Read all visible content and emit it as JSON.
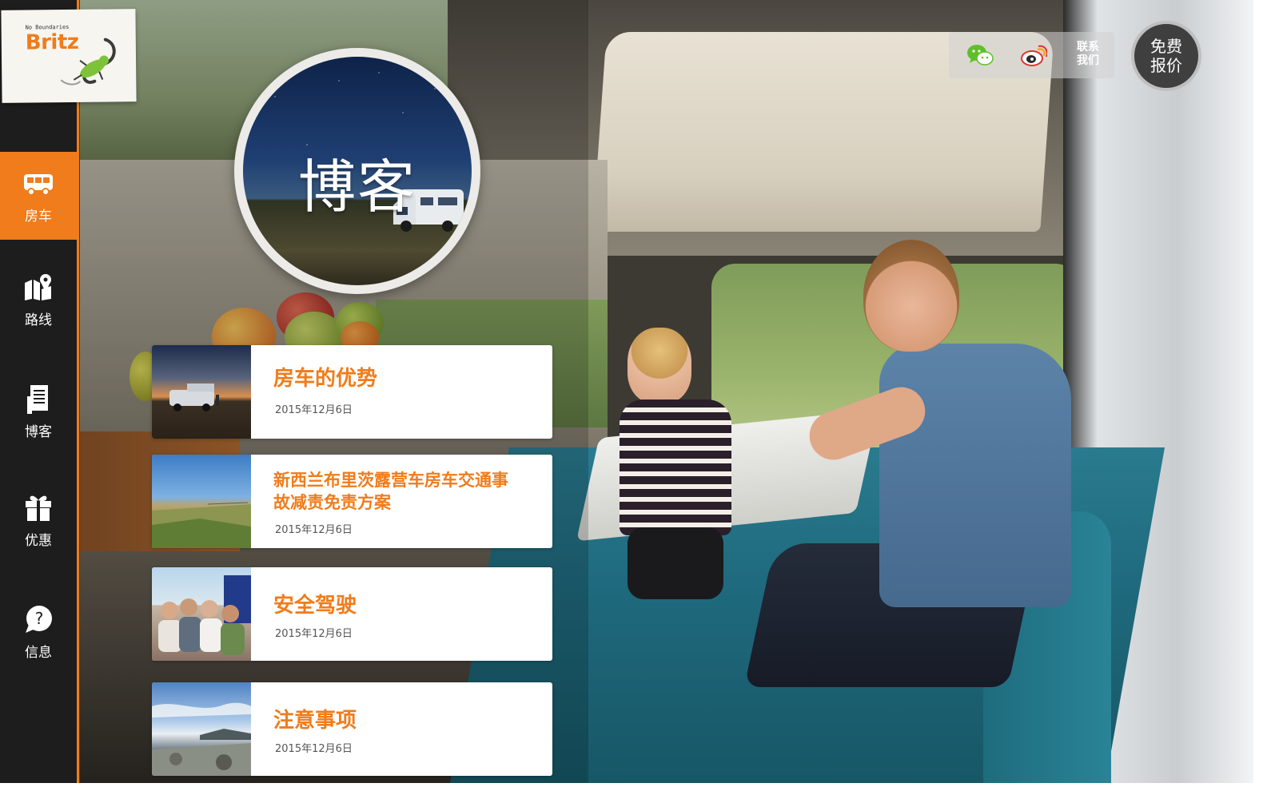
{
  "brand": {
    "tagline": "No Boundaries",
    "name": "Britz"
  },
  "sidebar": {
    "items": [
      {
        "label": "房车",
        "icon": "campervan-icon",
        "active": true
      },
      {
        "label": "路线",
        "icon": "map-pin-icon",
        "active": false
      },
      {
        "label": "博客",
        "icon": "document-icon",
        "active": false
      },
      {
        "label": "优惠",
        "icon": "gift-icon",
        "active": false
      },
      {
        "label": "信息",
        "icon": "help-bubble-icon",
        "active": false
      }
    ]
  },
  "hero": {
    "title": "博客"
  },
  "header": {
    "social": [
      {
        "icon": "wechat-icon"
      },
      {
        "icon": "weibo-icon"
      }
    ],
    "contact_line1": "联系",
    "contact_line2": "我们",
    "quote_line1": "免费",
    "quote_line2": "报价"
  },
  "posts": [
    {
      "title": "房车的优势",
      "date": "2015年12月6日"
    },
    {
      "title": "新西兰布里茨露营车房车交通事故减责免责方案",
      "date": "2015年12月6日"
    },
    {
      "title": "安全驾驶",
      "date": "2015年12月6日"
    },
    {
      "title": "注意事项",
      "date": "2015年12月6日"
    }
  ],
  "colors": {
    "accent": "#f07c1b",
    "sidebar_bg": "#1d1d1d"
  }
}
